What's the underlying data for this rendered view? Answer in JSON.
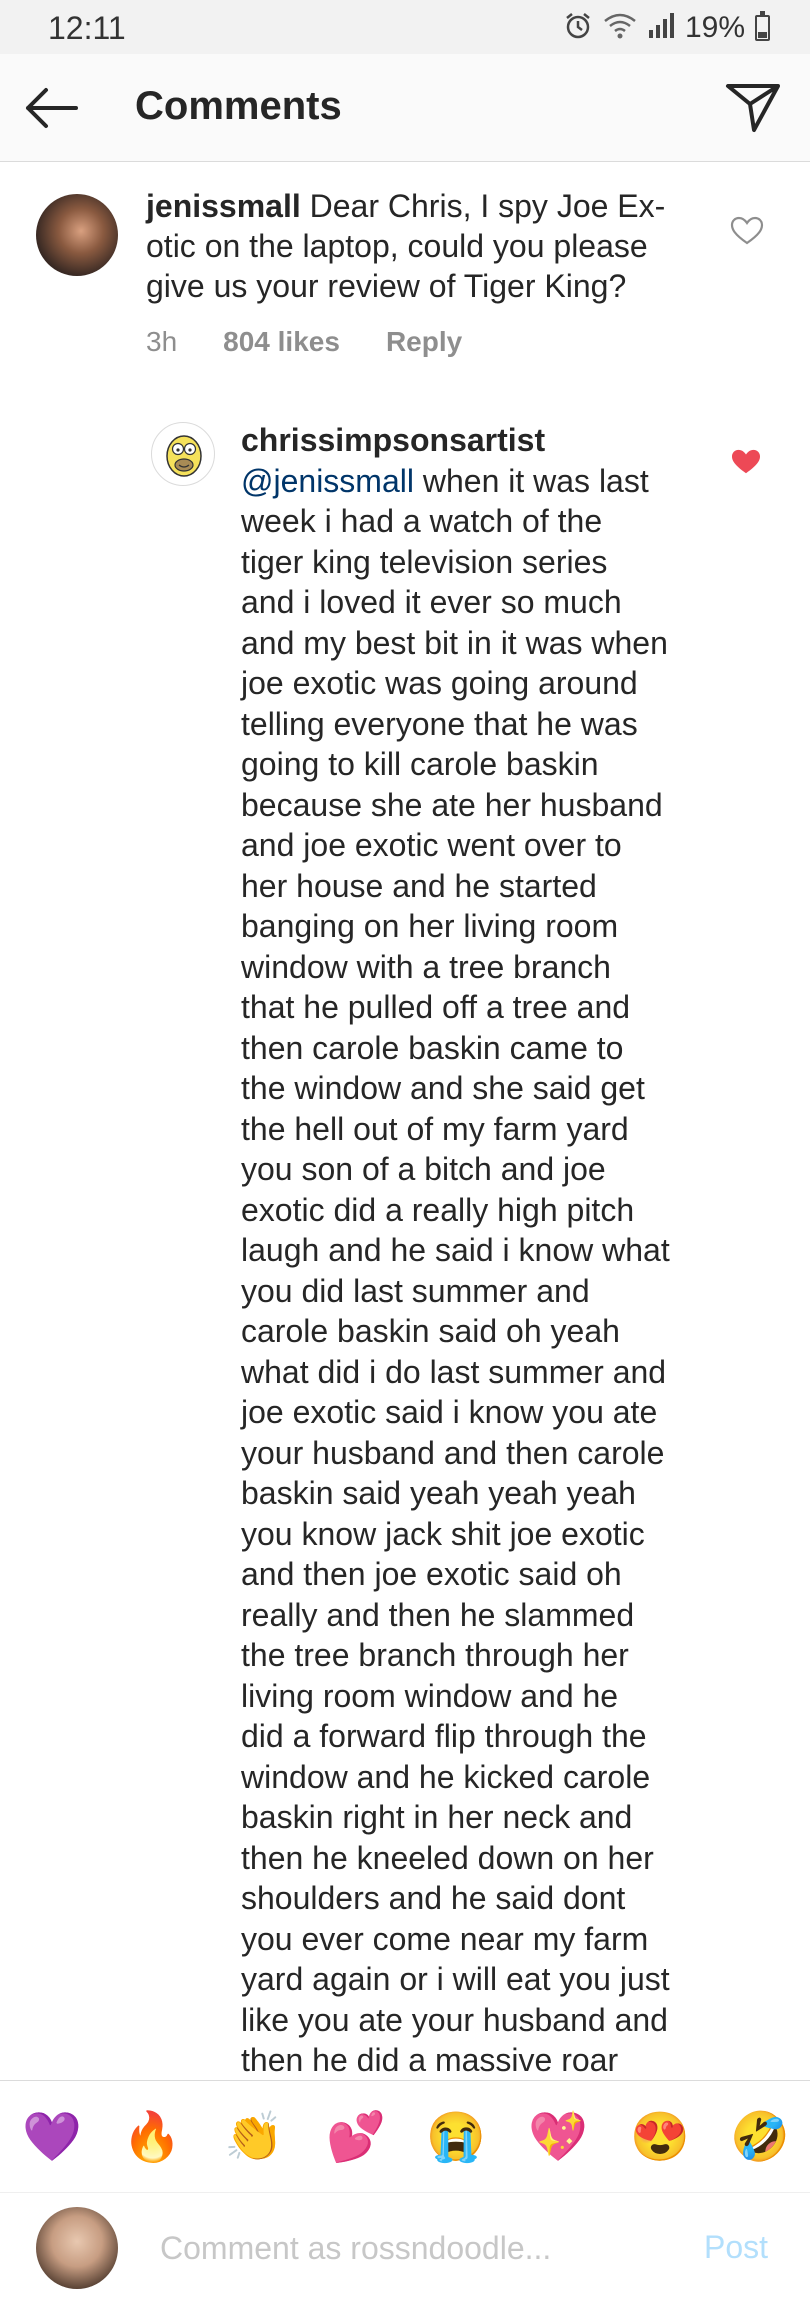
{
  "status_bar": {
    "time": "12:11",
    "battery_pct": "19%",
    "icons": [
      "alarm-icon",
      "wifi-icon",
      "signal-icon",
      "battery-icon"
    ]
  },
  "header": {
    "title": "Comments",
    "back_icon": "arrow-left-icon",
    "send_icon": "paper-plane-icon"
  },
  "comments": [
    {
      "username": "jenissmall",
      "text": "Dear Chris, I spy Joe Ex-otic on the laptop, could you please give us your review of Tiger King?",
      "time": "3h",
      "likes": "804 likes",
      "reply": "Reply",
      "liked": false
    },
    {
      "username": "chrissimpsonsartist",
      "mention": "@jenissmall",
      "text": " when it was last\nweek i had a watch of the\ntiger king television series\nand i loved it ever so much\nand my best bit in it was when\njoe exotic was going around\ntelling everyone that he was\ngoing to kill carole baskin\nbecause she ate her husband\nand joe exotic went over to\nher house and he started\nbanging on her living room\nwindow with a tree branch\nthat he pulled off a tree and\nthen carole baskin came to\nthe window and she said get\nthe hell out of my farm yard\nyou son of a bitch and joe\nexotic did a really high pitch\nlaugh and he said i know what\nyou did last summer and\ncarole baskin said oh yeah\nwhat did i do last summer and\njoe exotic said i know you ate\nyour husband and then carole\nbaskin said yeah yeah yeah\nyou know jack shit joe exotic\nand then joe exotic said oh\nreally and then he slammed\nthe tree branch through her\nliving room window and he\ndid a forward flip through the\nwindow and he kicked carole\nbaskin right in her neck and\nthen he kneeled down on her\nshoulders and he said dont\nyou ever come near my farm\nyard again or i will eat you just\nlike you ate your husband and\nthen he did a massive roar",
      "liked": true
    }
  ],
  "emoji_bar": [
    {
      "name": "purple-heart-emoji",
      "glyph": "💜"
    },
    {
      "name": "fire-emoji",
      "glyph": "🔥"
    },
    {
      "name": "clapping-hands-emoji",
      "glyph": "👏"
    },
    {
      "name": "two-hearts-emoji",
      "glyph": "💕"
    },
    {
      "name": "crying-face-emoji",
      "glyph": "😭"
    },
    {
      "name": "sparkling-heart-emoji",
      "glyph": "💖"
    },
    {
      "name": "heart-eyes-emoji",
      "glyph": "😍"
    },
    {
      "name": "rolling-laughing-emoji",
      "glyph": "🤣"
    }
  ],
  "comment_input": {
    "placeholder": "Comment as rossndoodle...",
    "post_label": "Post"
  },
  "colors": {
    "mention": "#003569",
    "like_red": "#ed4956",
    "post_disabled": "#b2dffc",
    "meta_gray": "#8e8e8e"
  }
}
